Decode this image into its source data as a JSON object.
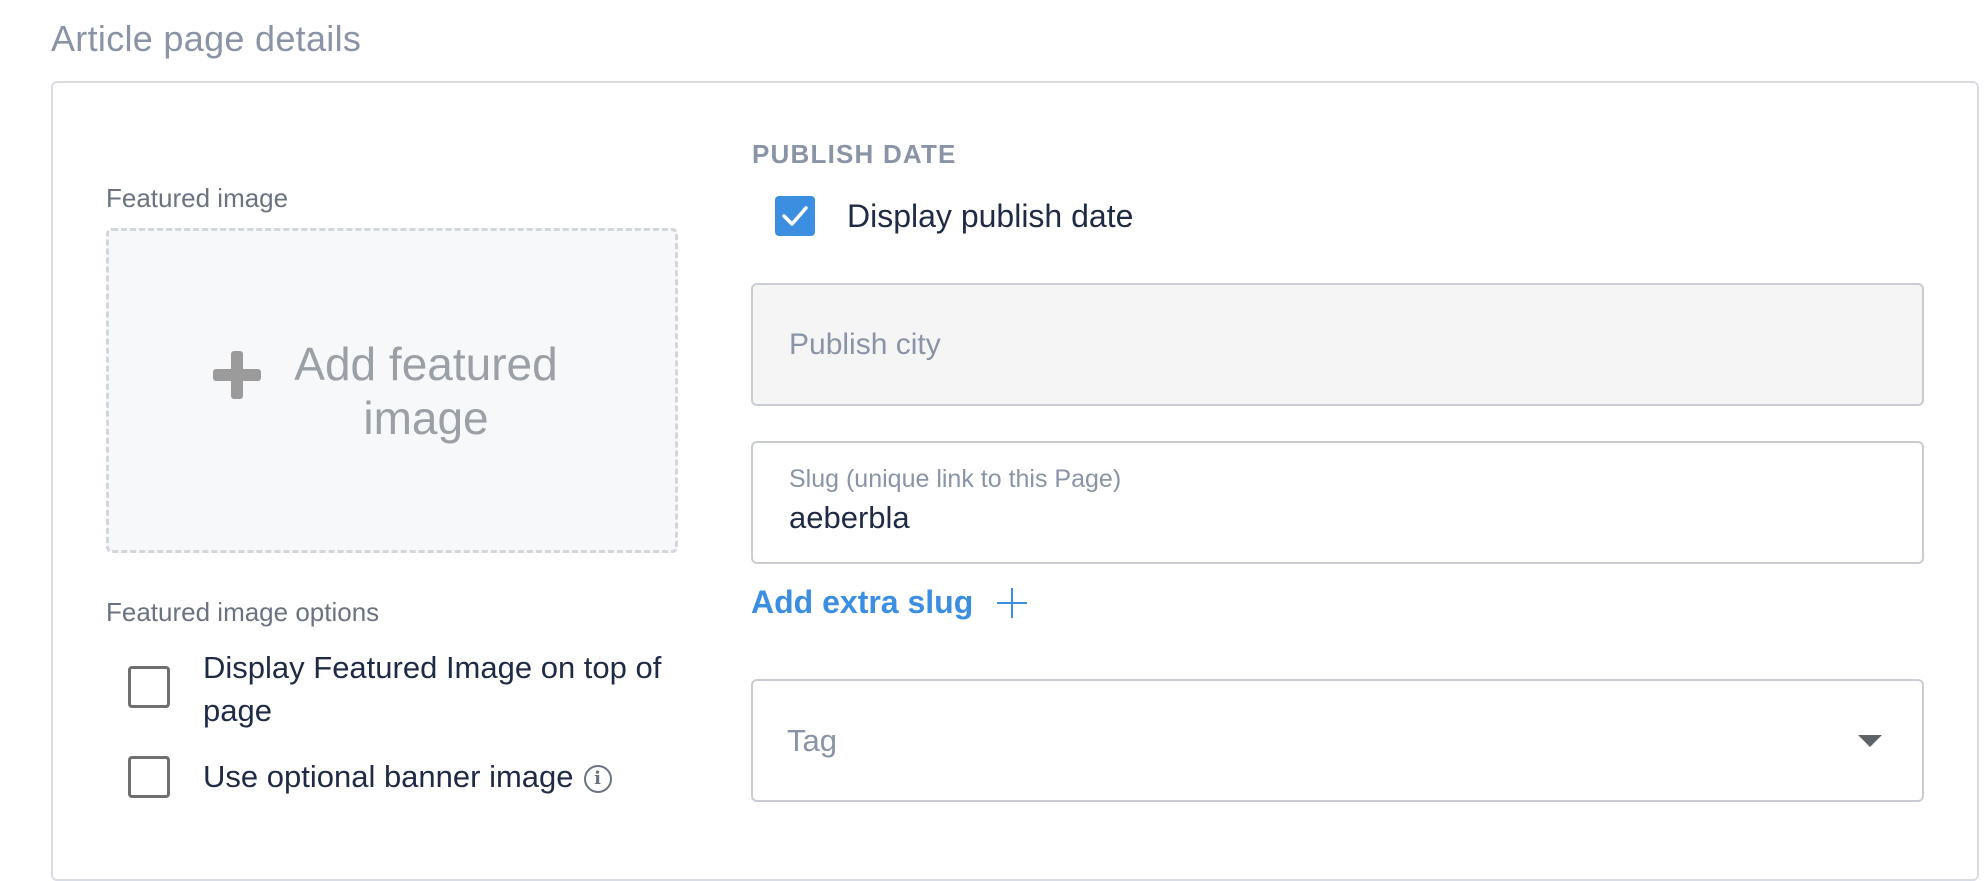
{
  "section": {
    "title": "Article page details"
  },
  "featured_image": {
    "label": "Featured image",
    "add_text": "Add featured image",
    "icon": "plus-icon"
  },
  "featured_image_options": {
    "label": "Featured image options",
    "display_on_top": {
      "label": "Display Featured Image on top of page",
      "checked": false
    },
    "banner": {
      "label": "Use optional banner image",
      "checked": false,
      "icon": "info-icon"
    }
  },
  "publish_date": {
    "heading": "PUBLISH DATE",
    "display_label": "Display publish date",
    "checked": true
  },
  "publish_city": {
    "placeholder": "Publish city",
    "value": ""
  },
  "slug": {
    "label": "Slug (unique link to this Page)",
    "value": "aeberbla"
  },
  "extra_slug": {
    "label": "Add extra slug"
  },
  "tag": {
    "placeholder": "Tag"
  },
  "colors": {
    "accent": "#3c8fe0",
    "muted": "#8a94a6",
    "text": "#1f2a44"
  }
}
